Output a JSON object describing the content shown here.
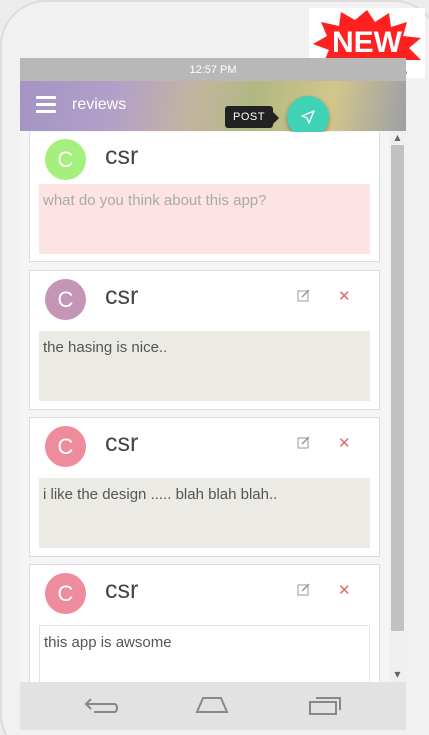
{
  "badge": {
    "text": "NEW",
    "color": "#ff2020"
  },
  "status_bar": {
    "time": "12:57 PM"
  },
  "app_bar": {
    "title": "reviews",
    "post_tooltip": "POST",
    "fab_color": "#3fd2b5"
  },
  "reviews": [
    {
      "author": "csr",
      "avatar_letter": "C",
      "avatar_color": "#a5ef7e",
      "text": "what do you think about this app?",
      "is_placeholder": true,
      "editable": false
    },
    {
      "author": "csr",
      "avatar_letter": "C",
      "avatar_color": "#c595b6",
      "text": "the hasing is nice..",
      "editable": true
    },
    {
      "author": "csr",
      "avatar_letter": "C",
      "avatar_color": "#ef8c9c",
      "text": "i like the design ..... blah blah blah..",
      "editable": true
    },
    {
      "author": "csr",
      "avatar_letter": "C",
      "avatar_color": "#ef8c9c",
      "text": "this app is awsome",
      "editable": true
    }
  ],
  "icons": {
    "menu": "hamburger-icon",
    "fab": "send-icon",
    "edit": "pencil-icon",
    "delete": "close-icon",
    "nav": [
      "back-icon",
      "home-icon",
      "recent-apps-icon"
    ]
  }
}
